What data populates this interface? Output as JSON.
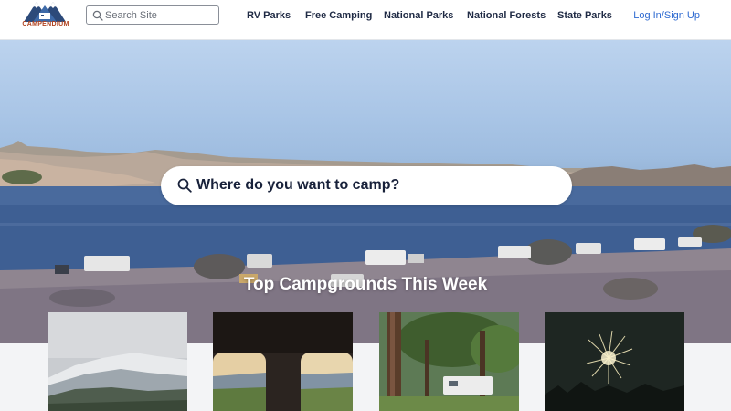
{
  "header": {
    "logo_text": "CAMPENDIUM",
    "search": {
      "placeholder": "Search Site",
      "value": "",
      "icon": "search-icon"
    },
    "nav": [
      {
        "label": "RV Parks"
      },
      {
        "label": "Free Camping"
      },
      {
        "label": "National Parks"
      },
      {
        "label": "National Forests"
      },
      {
        "label": "State Parks"
      }
    ],
    "login_label": "Log In/Sign Up"
  },
  "hero": {
    "search_label": "Where do you want to camp?",
    "search_icon": "search-icon"
  },
  "section": {
    "title": "Top Campgrounds This Week"
  },
  "cards": [
    {
      "image": "snowy-mountain-photo"
    },
    {
      "image": "window-mountain-view-photo"
    },
    {
      "image": "forest-trailer-photo"
    },
    {
      "image": "fireworks-photo"
    }
  ],
  "colors": {
    "brand": "#b0421f",
    "logo_blue": "#2c4a7a",
    "nav_text": "#1f2a44",
    "link": "#2e6ad1",
    "strip": "#f3f4f6"
  }
}
